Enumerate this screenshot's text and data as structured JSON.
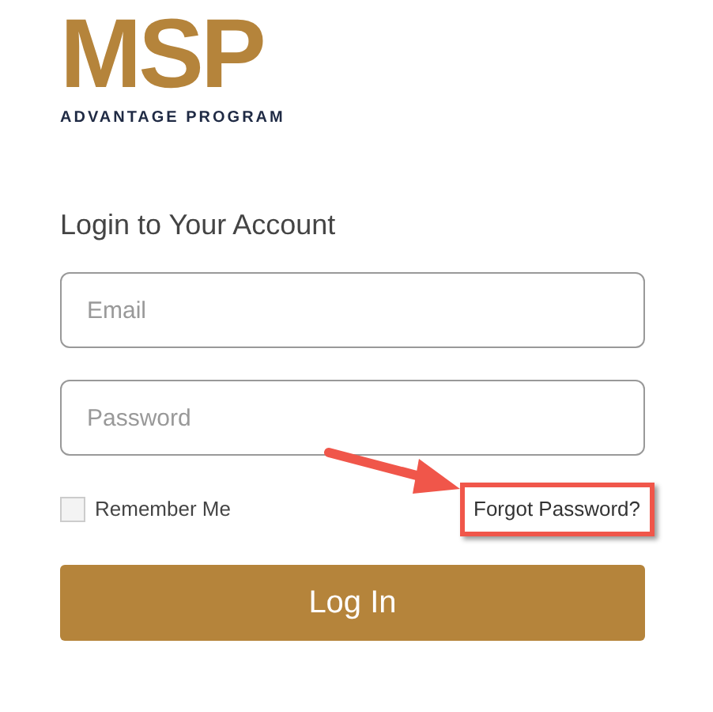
{
  "logo": {
    "mark": "MSP",
    "tagline": "ADVANTAGE PROGRAM"
  },
  "heading": "Login to Your Account",
  "fields": [
    {
      "placeholder": "Email"
    },
    {
      "placeholder": "Password"
    }
  ],
  "remember_me": {
    "label": "Remember Me",
    "checked": false
  },
  "forgot_link": {
    "label": "Forgot Password?",
    "highlighted": true
  },
  "submit": "Log In"
}
